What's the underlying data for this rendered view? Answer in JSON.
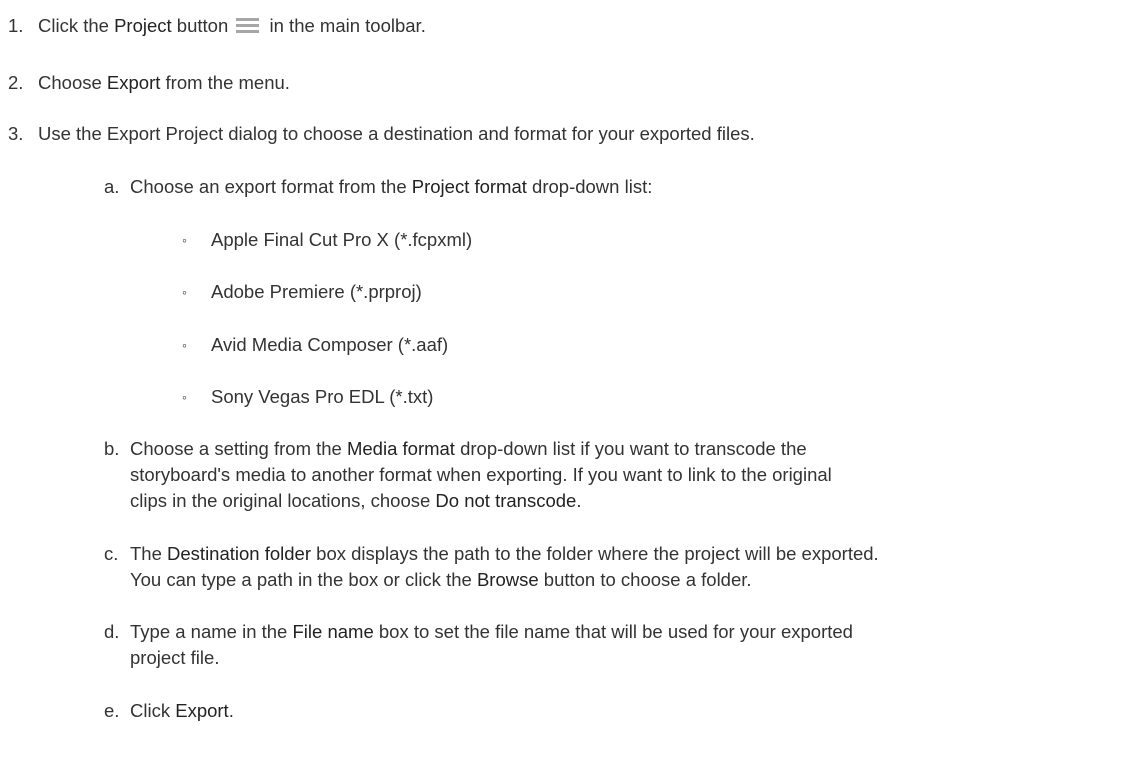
{
  "steps": [
    {
      "num": "1.",
      "before": "Click the ",
      "bold": "Project",
      "middle": " button ",
      "icon": "menu-icon",
      "after": " in the main toolbar."
    },
    {
      "num": "2.",
      "before": "Choose ",
      "bold": "Export",
      "after": " from the menu."
    },
    {
      "num": "3.",
      "text": "Use the Export Project dialog to choose a destination and format for your exported files."
    }
  ],
  "substeps": [
    {
      "letter": "a.",
      "before": "Choose an export format from the ",
      "bold": "Project format",
      "after": " drop-down list:"
    },
    {
      "letter": "b.",
      "line1_before": "Choose a setting from the ",
      "line1_bold": "Media format",
      "line1_after": " drop-down list if you want to transcode the",
      "line2": "storyboard's media to another format when exporting. If you want to link to the original",
      "line3_before": "clips in the original locations, choose ",
      "line3_bold": "Do not transcode",
      "line3_after": "."
    },
    {
      "letter": "c.",
      "line1_before": "The ",
      "line1_bold": "Destination folder",
      "line1_after": " box displays the path to the folder where the project will be exported.",
      "line2_before": "You can type a path in the box or click the ",
      "line2_bold": "Browse",
      "line2_after": " button to choose a folder."
    },
    {
      "letter": "d.",
      "line1_before": "Type a name in the ",
      "line1_bold": "File name",
      "line1_after": " box to set the file name that will be used for your exported",
      "line2": "project file."
    },
    {
      "letter": "e.",
      "before": "Click ",
      "bold": "Export",
      "after": "."
    }
  ],
  "formats": [
    "Apple Final Cut Pro X (*.fcpxml)",
    "Adobe Premiere (*.prproj)",
    "Avid Media Composer (*.aaf)",
    "Sony Vegas Pro EDL (*.txt)"
  ],
  "bullet_symbol": "◦",
  "colors": {
    "text": "#333333",
    "icon": "#a6a6a6"
  }
}
